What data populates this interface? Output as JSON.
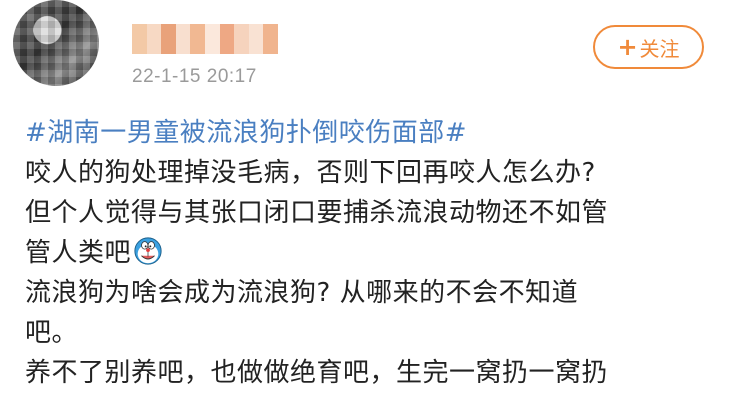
{
  "post_header": {
    "timestamp": "22-1-15 20:17",
    "follow_label": "关注",
    "follow_icon": "plus-icon",
    "name_blur_colors": [
      "#f3c9a6",
      "#f7d9c4",
      "#e9a27a",
      "#f8dfcf",
      "#f1b892",
      "#fbe8dc",
      "#eea884",
      "#f6d3bd",
      "#f9e2d3",
      "#f0b48e"
    ]
  },
  "post_body": {
    "hashtag": "#湖南一男童被流浪狗扑倒咬伤面部#",
    "lines": [
      "咬人的狗处理掉没毛病，否则下回再咬人怎么办?",
      "但个人觉得与其张口闭口要捕杀流浪动物还不如管",
      "管人类吧",
      "流浪狗为啥会成为流浪狗? 从哪来的不会不知道",
      "吧。",
      "养不了别养吧，也做做绝育吧，生完一窝扔一窝扔"
    ],
    "emoji": "doraemon-emoji"
  },
  "colors": {
    "accent_orange": "#f08a3a",
    "hashtag_blue": "#4a7fc1",
    "text": "#222222",
    "timestamp": "#9a9a9a"
  }
}
